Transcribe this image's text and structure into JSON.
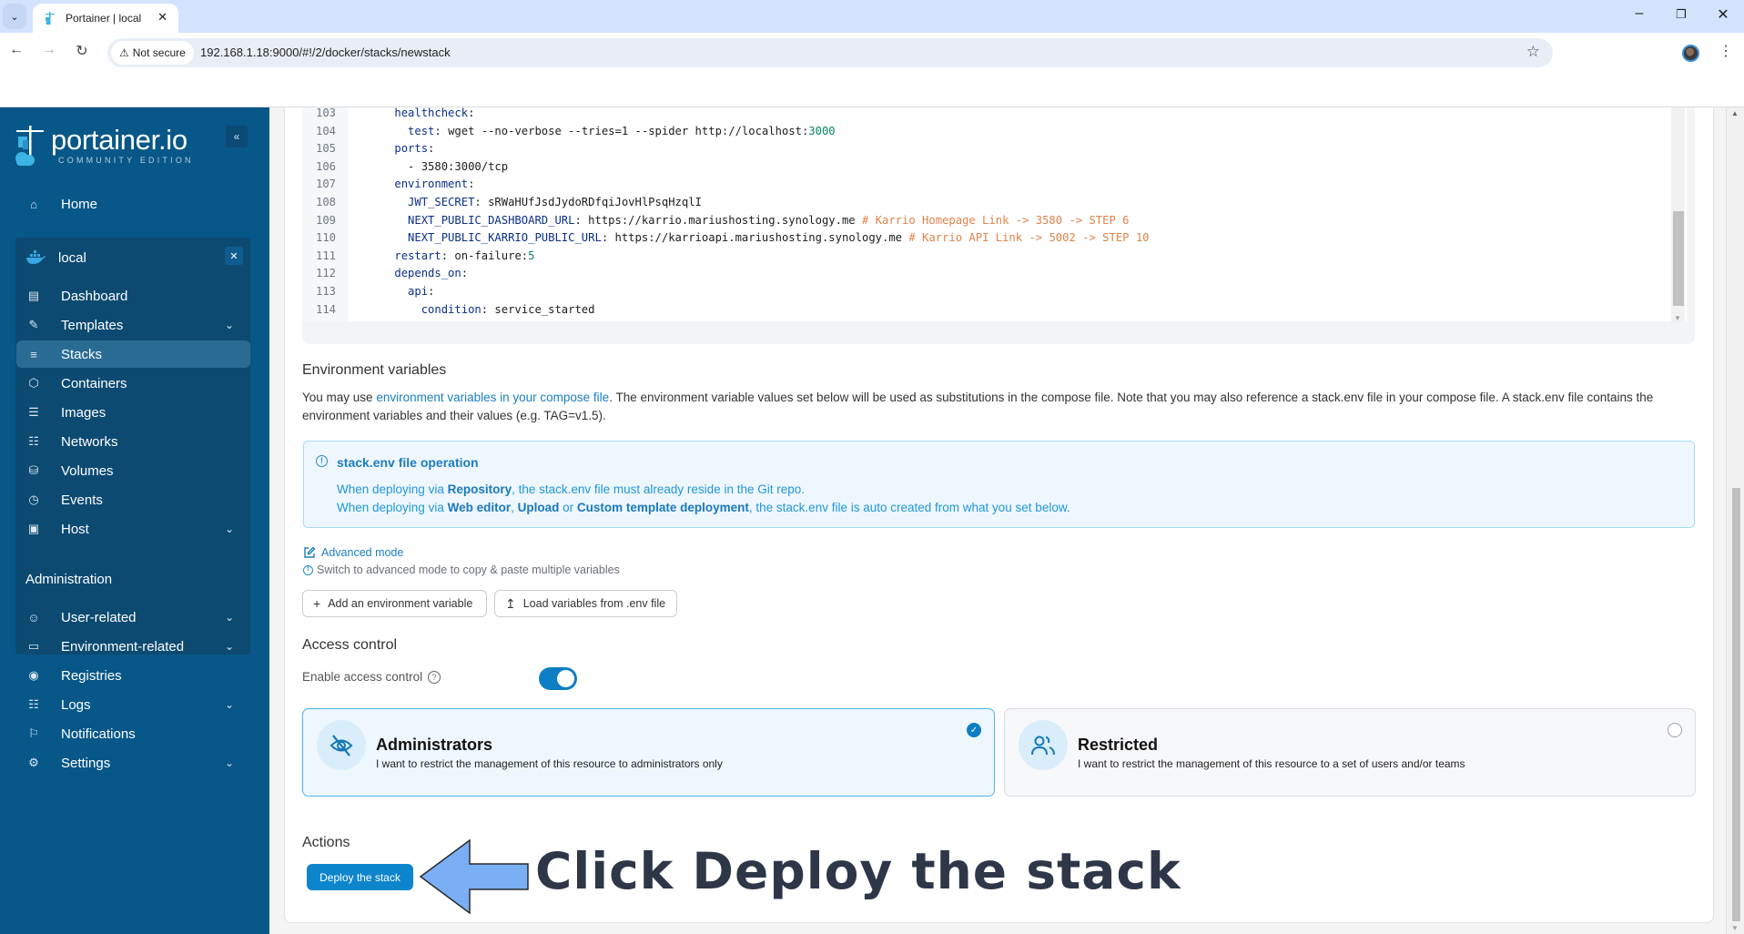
{
  "browser": {
    "tab_title": "Portainer | local",
    "security_label": "Not secure",
    "url": "192.168.1.18:9000/#!/2/docker/stacks/newstack"
  },
  "sidebar": {
    "logo_name": "portainer.io",
    "logo_edition": "COMMUNITY EDITION",
    "home": "Home",
    "environment": {
      "name": "local"
    },
    "env_items": [
      {
        "label": "Dashboard",
        "icon": "dashboard-icon",
        "expandable": false,
        "active": false
      },
      {
        "label": "Templates",
        "icon": "edit-icon",
        "expandable": true,
        "active": false
      },
      {
        "label": "Stacks",
        "icon": "layers-icon",
        "expandable": false,
        "active": true
      },
      {
        "label": "Containers",
        "icon": "box-icon",
        "expandable": false,
        "active": false
      },
      {
        "label": "Images",
        "icon": "list-icon",
        "expandable": false,
        "active": false
      },
      {
        "label": "Networks",
        "icon": "network-icon",
        "expandable": false,
        "active": false
      },
      {
        "label": "Volumes",
        "icon": "database-icon",
        "expandable": false,
        "active": false
      },
      {
        "label": "Events",
        "icon": "clock-icon",
        "expandable": false,
        "active": false
      },
      {
        "label": "Host",
        "icon": "host-icon",
        "expandable": true,
        "active": false
      }
    ],
    "admin_heading": "Administration",
    "admin_items": [
      {
        "label": "User-related",
        "icon": "users-icon",
        "expandable": true
      },
      {
        "label": "Environment-related",
        "icon": "drive-icon",
        "expandable": true
      },
      {
        "label": "Registries",
        "icon": "radio-icon",
        "expandable": false
      },
      {
        "label": "Logs",
        "icon": "file-icon",
        "expandable": true
      },
      {
        "label": "Notifications",
        "icon": "bell-icon",
        "expandable": false
      },
      {
        "label": "Settings",
        "icon": "gear-icon",
        "expandable": true
      }
    ]
  },
  "editor": {
    "lines": [
      {
        "n": "103",
        "indent": 4,
        "parts": [
          [
            "k",
            "healthcheck"
          ],
          [
            "v",
            ":"
          ]
        ]
      },
      {
        "n": "104",
        "indent": 6,
        "parts": [
          [
            "k",
            "test"
          ],
          [
            "v",
            ": wget --no-verbose --tries=1 --spider http://localhost:"
          ],
          [
            "n",
            "3000"
          ]
        ]
      },
      {
        "n": "105",
        "indent": 4,
        "parts": [
          [
            "k",
            "ports"
          ],
          [
            "v",
            ":"
          ]
        ]
      },
      {
        "n": "106",
        "indent": 6,
        "parts": [
          [
            "v",
            "- 3580:3000/tcp"
          ]
        ]
      },
      {
        "n": "107",
        "indent": 4,
        "parts": [
          [
            "k",
            "environment"
          ],
          [
            "v",
            ":"
          ]
        ]
      },
      {
        "n": "108",
        "indent": 6,
        "parts": [
          [
            "k",
            "JWT_SECRET"
          ],
          [
            "v",
            ": sRWaHUfJsdJydoRDfqiJovHlPsqHzqlI"
          ]
        ]
      },
      {
        "n": "109",
        "indent": 6,
        "parts": [
          [
            "k",
            "NEXT_PUBLIC_DASHBOARD_URL"
          ],
          [
            "v",
            ": https://karrio.mariushosting.synology.me "
          ],
          [
            "c",
            "# Karrio Homepage Link -> 3580 -> STEP 6"
          ]
        ]
      },
      {
        "n": "110",
        "indent": 6,
        "parts": [
          [
            "k",
            "NEXT_PUBLIC_KARRIO_PUBLIC_URL"
          ],
          [
            "v",
            ": https://karrioapi.mariushosting.synology.me "
          ],
          [
            "c",
            "# Karrio API Link -> 5002 -> STEP 10"
          ]
        ]
      },
      {
        "n": "111",
        "indent": 4,
        "parts": [
          [
            "k",
            "restart"
          ],
          [
            "v",
            ": on-failure:"
          ],
          [
            "n",
            "5"
          ]
        ]
      },
      {
        "n": "112",
        "indent": 4,
        "parts": [
          [
            "k",
            "depends_on"
          ],
          [
            "v",
            ":"
          ]
        ]
      },
      {
        "n": "113",
        "indent": 6,
        "parts": [
          [
            "k",
            "api"
          ],
          [
            "v",
            ":"
          ]
        ]
      },
      {
        "n": "114",
        "indent": 8,
        "parts": [
          [
            "k",
            "condition"
          ],
          [
            "v",
            ": service_started"
          ]
        ]
      }
    ]
  },
  "env_vars": {
    "title": "Environment variables",
    "desc_prefix": "You may use ",
    "desc_link": "environment variables in your compose file",
    "desc_rest": ". The environment variable values set below will be used as substitutions in the compose file. Note that you may also reference a stack.env file in your compose file. A stack.env file contains the environment variables and their values (e.g. TAG=v1.5).",
    "info_title": "stack.env file operation",
    "info_line1": {
      "a": "When deploying via ",
      "b1": "Repository",
      "c": ", the stack.env file must already reside in the Git repo."
    },
    "info_line2": {
      "a": "When deploying via ",
      "b1": "Web editor",
      "s1": ", ",
      "b2": "Upload",
      "s2": " or ",
      "b3": "Custom template deployment",
      "c": ", the stack.env file is auto created from what you set below."
    },
    "advanced_mode": "Advanced mode",
    "advanced_hint": "Switch to advanced mode to copy & paste multiple variables",
    "add_button": "Add an environment variable",
    "load_button": "Load variables from .env file"
  },
  "access_control": {
    "title": "Access control",
    "enable_label": "Enable access control",
    "enabled": true,
    "options": [
      {
        "title": "Administrators",
        "desc": "I want to restrict the management of this resource to administrators only",
        "selected": true
      },
      {
        "title": "Restricted",
        "desc": "I want to restrict the management of this resource to a set of users and/or teams",
        "selected": false
      }
    ]
  },
  "actions": {
    "title": "Actions",
    "deploy_button": "Deploy the stack"
  },
  "annotation": {
    "text": "Click Deploy the stack",
    "arrow_color": "#7aaef5"
  }
}
